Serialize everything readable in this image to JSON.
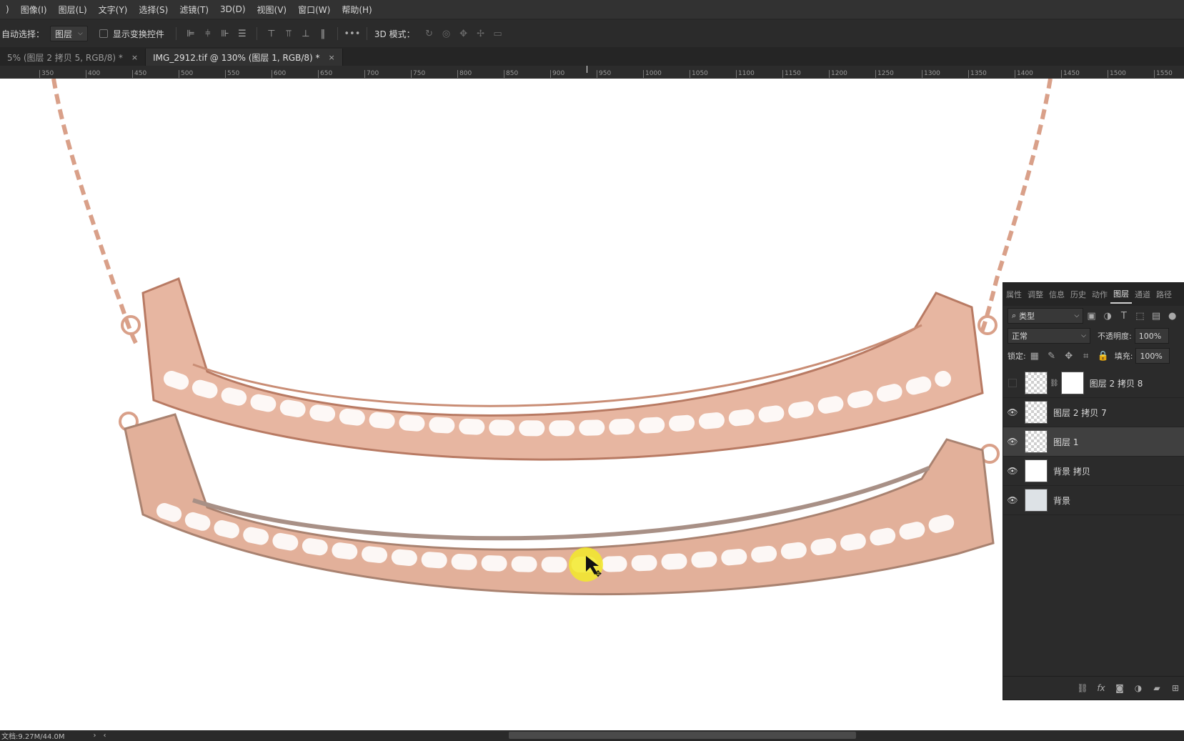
{
  "menu": [
    "图像(I)",
    "图层(L)",
    "文字(Y)",
    "选择(S)",
    "滤镜(T)",
    "3D(D)",
    "视图(V)",
    "窗口(W)",
    "帮助(H)"
  ],
  "menu_partial": ")",
  "options": {
    "auto_select_label": "自动选择：",
    "auto_select_value": "图层",
    "show_transform_label": "显示变换控件",
    "more": "•••",
    "mode_3d_label": "3D 模式："
  },
  "tabs": [
    {
      "label": "5% (图层 2 拷贝 5, RGB/8) *",
      "close": "×",
      "active": false
    },
    {
      "label": "IMG_2912.tif @ 130% (图层 1, RGB/8) *",
      "close": "×",
      "active": true
    }
  ],
  "ruler": [
    "350",
    "400",
    "450",
    "500",
    "550",
    "600",
    "650",
    "700",
    "750",
    "800",
    "850",
    "900",
    "950",
    "1000",
    "1050",
    "1100",
    "1150",
    "1200",
    "1250",
    "1300",
    "1350",
    "1400",
    "1450",
    "1500",
    "1550"
  ],
  "status": {
    "doc": "文档:9.27M/44.0M",
    "arrow": "›",
    "arrow_left": "‹"
  },
  "panel": {
    "tabs": [
      "属性",
      "调整",
      "信息",
      "历史",
      "动作",
      "图层",
      "通道",
      "路径"
    ],
    "active_tab": "图层",
    "filter_value": "类型",
    "blend_mode": "正常",
    "opacity_label": "不透明度:",
    "opacity_value": "100%",
    "lock_label": "锁定:",
    "fill_label": "填充:",
    "fill_value": "100%",
    "layers": [
      {
        "name": "图层 2 拷贝 8",
        "visible": false,
        "mask": true,
        "selected": false
      },
      {
        "name": "图层 2 拷贝 7",
        "visible": true,
        "mask": false,
        "selected": false
      },
      {
        "name": "图层 1",
        "visible": true,
        "mask": false,
        "selected": true
      },
      {
        "name": "背景 拷贝",
        "visible": true,
        "mask": false,
        "selected": false
      },
      {
        "name": "背景",
        "visible": true,
        "mask": false,
        "selected": false
      }
    ],
    "footer_icons": [
      "link-icon",
      "fx-icon",
      "mask-icon",
      "adjustment-icon",
      "folder-icon",
      "new-layer-icon"
    ],
    "fx_label": "fx"
  },
  "colors": {
    "gold": "#d9a089",
    "gold_dark": "#b87a63",
    "highlight": "#f2ea2a"
  }
}
